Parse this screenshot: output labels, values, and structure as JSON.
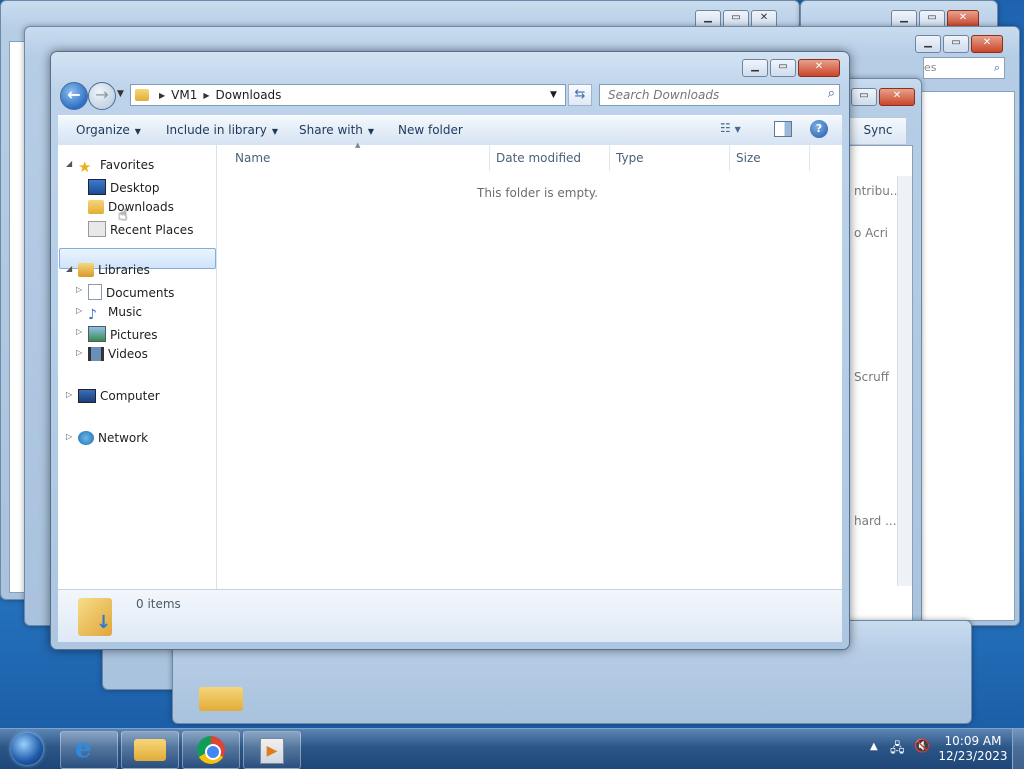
{
  "window": {
    "breadcrumb": [
      "VM1",
      "Downloads"
    ],
    "search_placeholder": "Search Downloads"
  },
  "toolbar": {
    "organize": "Organize",
    "include_in_library": "Include in library",
    "share_with": "Share with",
    "new_folder": "New folder"
  },
  "nav_pane": {
    "favorites": "Favorites",
    "favorites_items": [
      "Desktop",
      "Downloads",
      "Recent Places"
    ],
    "libraries": "Libraries",
    "libraries_items": [
      "Documents",
      "Music",
      "Pictures",
      "Videos"
    ],
    "computer": "Computer",
    "network": "Network"
  },
  "columns": [
    "Name",
    "Date modified",
    "Type",
    "Size"
  ],
  "empty_message": "This folder is empty.",
  "details": {
    "item_count": "0 items"
  },
  "background_window": {
    "search_fragment": "es",
    "sync_label": "Sync",
    "text_fragments": [
      "ntribu...",
      "o Acri",
      "Scruff",
      "hard ..."
    ]
  },
  "taskbar": {
    "time": "10:09 AM",
    "date": "12/23/2023"
  },
  "colors": {
    "accent": "#2d6fc4",
    "selection": "#cfe4fa",
    "taskbar": "#2c5687"
  }
}
